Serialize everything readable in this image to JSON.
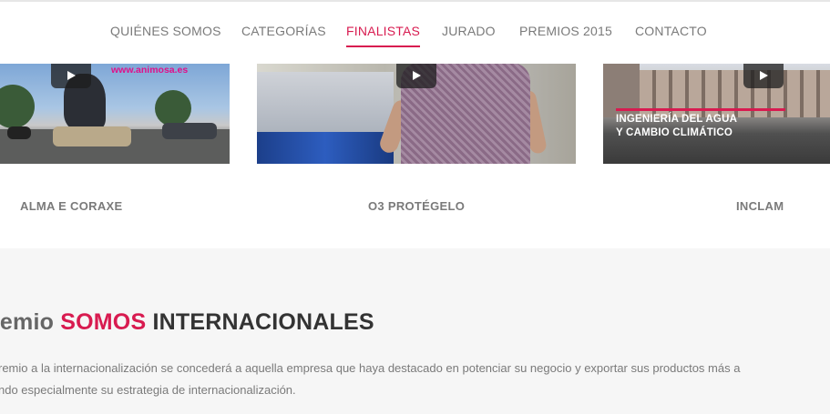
{
  "nav": {
    "items": [
      {
        "label": "QUIÉNES SOMOS",
        "active": false
      },
      {
        "label": "CATEGORÍAS",
        "active": false
      },
      {
        "label": "FINALISTAS",
        "active": true
      },
      {
        "label": "JURADO",
        "active": false
      },
      {
        "label": "PREMIOS 2015",
        "active": false
      },
      {
        "label": "CONTACTO",
        "active": false
      }
    ]
  },
  "colors": {
    "accent": "#d81b50",
    "nav_text": "#7a7a7a",
    "section_bg": "#f6f6f6"
  },
  "videos": [
    {
      "watermark": "www.animosa.es",
      "caption_lines": []
    },
    {
      "watermark": "",
      "caption_lines": []
    },
    {
      "watermark": "",
      "caption_lines": [
        "INGENIERÍA DEL AGUA",
        "Y CAMBIO CLIMÁTICO"
      ]
    }
  ],
  "finalists": [
    "ALMA E CORAXE",
    "O3 PROTÉGELO",
    "INCLAM"
  ],
  "section": {
    "title_prefix": "remio",
    "title_accent": "SOMOS",
    "title_rest": "INTERNACIONALES",
    "body_lines": [
      "remio a la internacionalización se concederá a aquella empresa que haya destacado en potenciar su negocio y exportar sus productos más a",
      "ndo especialmente su estrategia de internacionalización."
    ]
  },
  "icons": {
    "play": "play-icon"
  }
}
